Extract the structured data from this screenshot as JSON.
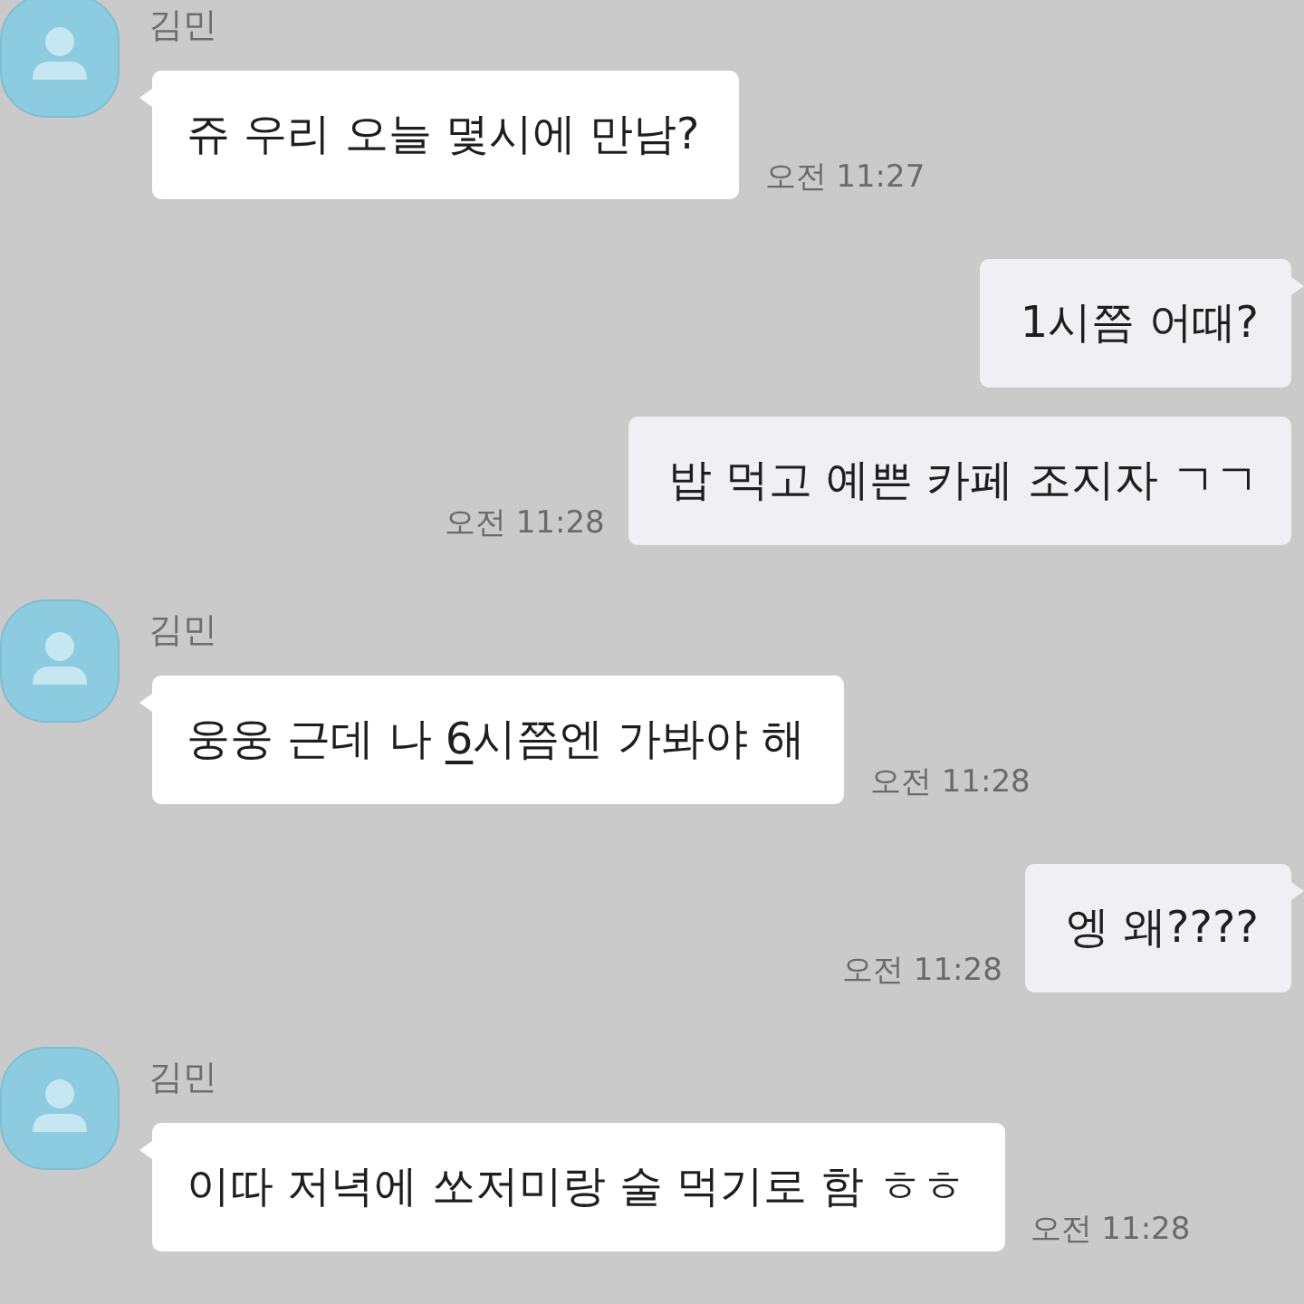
{
  "messages": [
    {
      "kind": "received",
      "sender": "김민",
      "segments": [
        {
          "text": "쥬 우리 오늘 몇시에 만남?",
          "underlined": false
        }
      ],
      "time": "오전 11:27"
    },
    {
      "kind": "sent",
      "segments": [
        {
          "text": "1시쯤 어때?",
          "underlined": false
        }
      ]
    },
    {
      "kind": "sent",
      "segments": [
        {
          "text": "밥 먹고 예쁜 카페 조지자 ㄱㄱ",
          "underlined": false
        }
      ],
      "time": "오전 11:28"
    },
    {
      "kind": "received",
      "sender": "김민",
      "segments": [
        {
          "text": "웅웅 근데 나 ",
          "underlined": false
        },
        {
          "text": "6",
          "underlined": true
        },
        {
          "text": "시쯤엔 가봐야 해",
          "underlined": false
        }
      ],
      "time": "오전 11:28"
    },
    {
      "kind": "sent",
      "segments": [
        {
          "text": "엥 왜????",
          "underlined": false
        }
      ],
      "time": "오전 11:28"
    },
    {
      "kind": "received",
      "sender": "김민",
      "segments": [
        {
          "text": "이따 저녁에 쏘저미랑 술 먹기로 함 ㅎㅎ",
          "underlined": false
        }
      ],
      "time": "오전 11:28"
    }
  ]
}
